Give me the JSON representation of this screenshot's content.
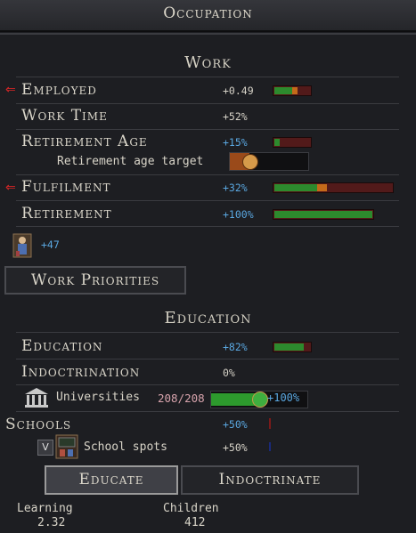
{
  "header": {
    "title": "Occupation"
  },
  "work": {
    "title": "Work",
    "employed": {
      "label": "Employed",
      "value": "+0.49",
      "fill": 0.5,
      "orange": 0.15
    },
    "work_time": {
      "label": "Work Time",
      "value": "+52%"
    },
    "retirement_age": {
      "label": "Retirement Age",
      "value": "+15%",
      "fill": 0.15
    },
    "retirement_target": {
      "label": "Retirement age target",
      "slider": 0.2
    },
    "fulfilment": {
      "label": "Fulfilment",
      "value": "+32%",
      "fill": 0.36,
      "orange": 0.08
    },
    "retirement": {
      "label": "Retirement",
      "value": "+100%",
      "fill": 1.0
    },
    "pop_value": "+47",
    "priorities_button": "Work Priorities"
  },
  "education": {
    "title": "Education",
    "education": {
      "label": "Education",
      "value": "+82%",
      "fill": 0.82
    },
    "indoctrination": {
      "label": "Indoctrination",
      "value": "0%"
    },
    "universities": {
      "label": "Universities",
      "count": "208/208",
      "value": "+100%",
      "fill": 1.0
    },
    "schools": {
      "label": "Schools",
      "value": "+50%"
    },
    "school_spots": {
      "label": "School spots",
      "value": "+50%",
      "checkbox": "V"
    },
    "educate_button": "Educate",
    "indoctrinate_button": "Indoctrinate"
  },
  "footer": {
    "learning_label": "Learning",
    "learning_value": "2.32",
    "children_label": "Children",
    "children_value": "412"
  },
  "colors": {
    "green": "#2d8a2d",
    "red": "#521a1a",
    "orange": "#c46a1a",
    "blue": "#5aa7e0"
  }
}
